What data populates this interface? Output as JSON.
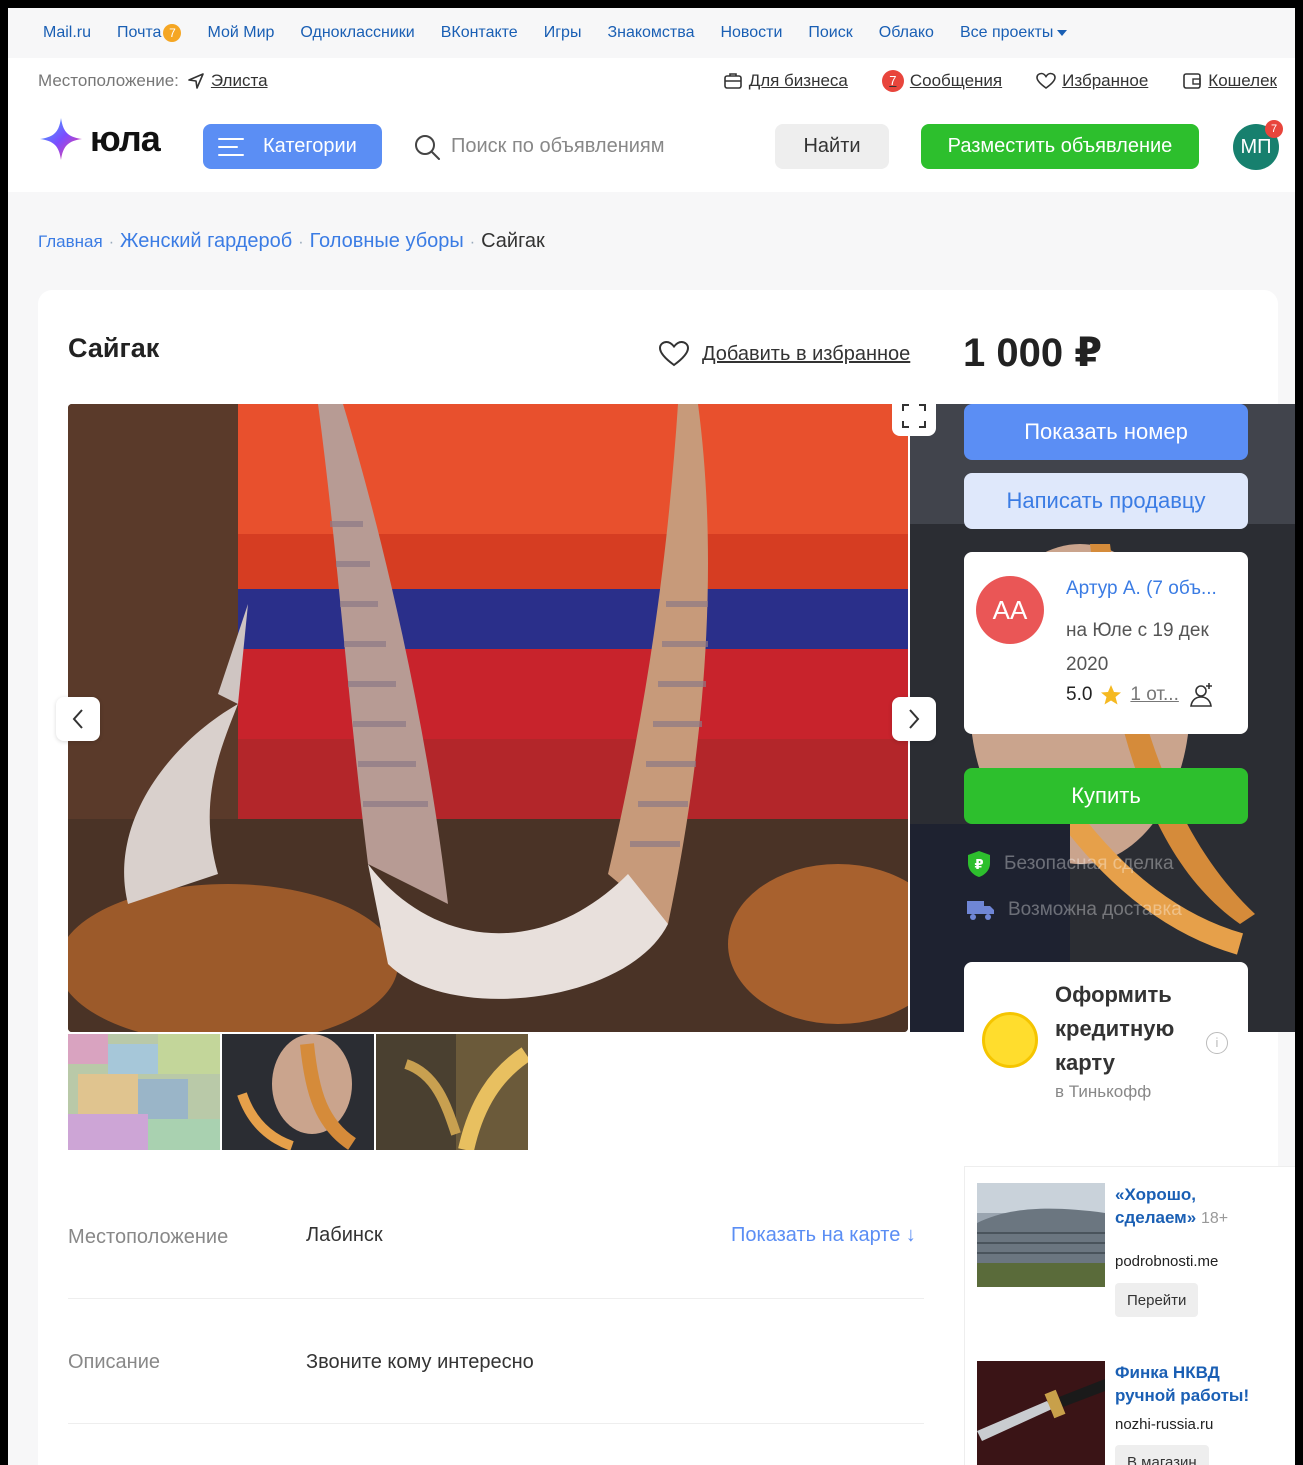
{
  "portal": {
    "links": [
      {
        "label": "Mail.ru"
      },
      {
        "label": "Почта",
        "badge": "7"
      },
      {
        "label": "Мой Мир"
      },
      {
        "label": "Одноклассники"
      },
      {
        "label": "ВКонтакте"
      },
      {
        "label": "Игры"
      },
      {
        "label": "Знакомства"
      },
      {
        "label": "Новости"
      },
      {
        "label": "Поиск"
      },
      {
        "label": "Облако"
      },
      {
        "label": "Все проекты"
      }
    ]
  },
  "header": {
    "location_label": "Местоположение:",
    "location_city": "Элиста",
    "business": "Для бизнеса",
    "messages": "Сообщения",
    "messages_badge": "7",
    "favorites": "Избранное",
    "wallet": "Кошелек",
    "logo_text": "юла",
    "categories": "Категории",
    "search_placeholder": "Поиск по объявлениям",
    "find": "Найти",
    "post_ad": "Разместить объявление",
    "avatar": "МП",
    "avatar_badge": "7"
  },
  "breadcrumb": {
    "home": "Главная",
    "cat1": "Женский гардероб",
    "cat2": "Головные уборы",
    "current": "Сайгак"
  },
  "listing": {
    "title": "Сайгак",
    "add_favorite": "Добавить в избранное",
    "price": "1 000 ₽"
  },
  "panel": {
    "show_number": "Показать номер",
    "write_seller": "Написать продавцу",
    "seller_initials": "АА",
    "seller_name": "Артур А. (7 объ...",
    "seller_since": "на Юле с 19 дек 2020",
    "rating": "5.0",
    "reviews": "1 от...",
    "buy": "Купить",
    "safe_deal": "Безопасная сделка",
    "delivery": "Возможна доставка",
    "credit_title": "Оформить кредитную карту",
    "credit_sub": "в Тинькофф",
    "colors": {
      "blue": "#5b8ef4",
      "green": "#2dbf2d"
    }
  },
  "ads": [
    {
      "title": "«Хорошо, сделаем»",
      "age": "18+",
      "domain": "podrobnosti.me",
      "action": "Перейти"
    },
    {
      "title": "Финка НКВД ручной работы!",
      "domain": "nozhi-russia.ru",
      "action": "В магазин"
    }
  ],
  "details": {
    "location_label": "Местоположение",
    "location_value": "Лабинск",
    "show_on_map": "Показать на карте ↓",
    "description_label": "Описание",
    "description_value": "Звоните кому интересно"
  }
}
